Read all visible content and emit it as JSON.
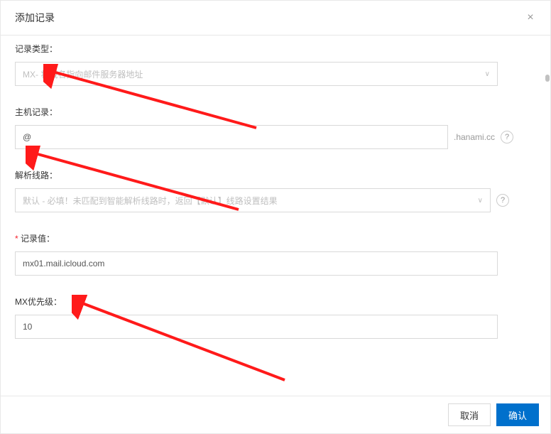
{
  "modal": {
    "title": "添加记录",
    "close": "×"
  },
  "fields": {
    "recordType": {
      "label": "记录类型：",
      "value": "MX- 将域名指向邮件服务器地址"
    },
    "hostRecord": {
      "label": "主机记录：",
      "value": "@",
      "suffix": ".hanami.cc",
      "help": "?"
    },
    "resolveLine": {
      "label": "解析线路：",
      "value": "默认 - 必填！未匹配到智能解析线路时，返回【默认】线路设置结果",
      "help": "?"
    },
    "recordValue": {
      "label": "记录值：",
      "value": "mx01.mail.icloud.com"
    },
    "mxPriority": {
      "label": "MX优先级：",
      "value": "10"
    }
  },
  "footer": {
    "cancel": "取消",
    "confirm": "确认"
  }
}
